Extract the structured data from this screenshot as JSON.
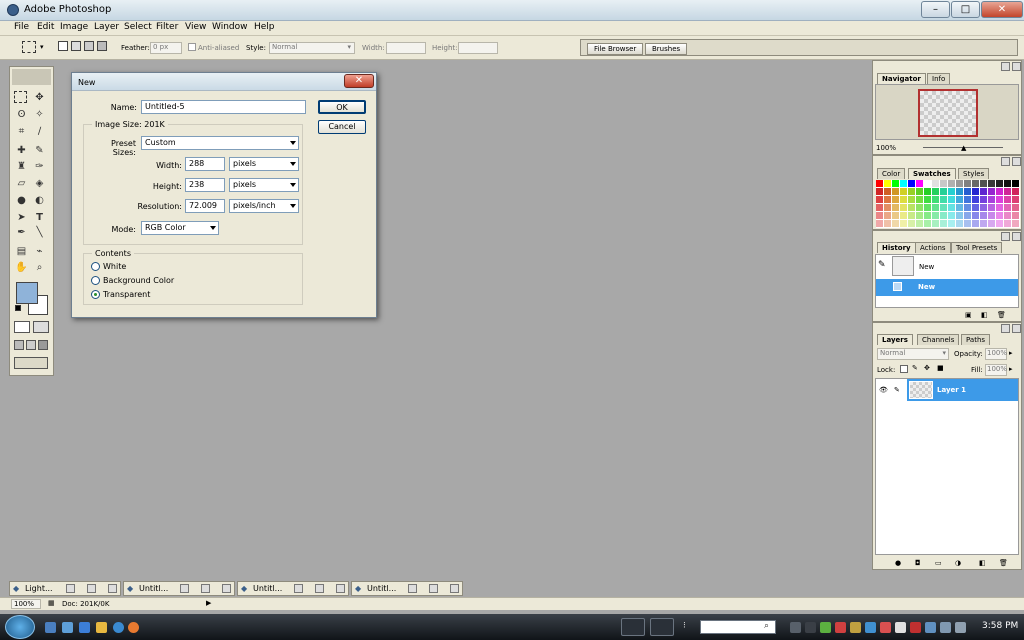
{
  "app": {
    "title": "Adobe Photoshop"
  },
  "menu": [
    "File",
    "Edit",
    "Image",
    "Layer",
    "Select",
    "Filter",
    "View",
    "Window",
    "Help"
  ],
  "options": {
    "feather_label": "Feather:",
    "feather_value": "0 px",
    "antialiased": "Anti-aliased",
    "style_label": "Style:",
    "style_value": "Normal",
    "width_label": "Width:",
    "height_label": "Height:",
    "well_tabs": [
      "File Browser",
      "Brushes"
    ]
  },
  "dialog": {
    "title": "New",
    "name_label": "Name:",
    "name_value": "Untitled-5",
    "image_size": "Image Size: 201K",
    "preset_label": "Preset Sizes:",
    "preset_value": "Custom",
    "width_label": "Width:",
    "width_value": "288",
    "width_unit": "pixels",
    "height_label": "Height:",
    "height_value": "238",
    "height_unit": "pixels",
    "res_label": "Resolution:",
    "res_value": "72.009",
    "res_unit": "pixels/inch",
    "mode_label": "Mode:",
    "mode_value": "RGB Color",
    "contents_label": "Contents",
    "contents": [
      "White",
      "Background Color",
      "Transparent"
    ],
    "selected_content": 2,
    "ok": "OK",
    "cancel": "Cancel"
  },
  "navigator": {
    "tabs": [
      "Navigator",
      "Info"
    ],
    "zoom": "100%"
  },
  "color_panel": {
    "tabs": [
      "Color",
      "Swatches",
      "Styles"
    ]
  },
  "history": {
    "tabs": [
      "History",
      "Actions",
      "Tool Presets"
    ],
    "snapshot": "New",
    "items": [
      "New"
    ]
  },
  "layers": {
    "tabs": [
      "Layers",
      "Channels",
      "Paths"
    ],
    "blend": "Normal",
    "opacity_label": "Opacity:",
    "opacity": "100%",
    "lock_label": "Lock:",
    "fill_label": "Fill:",
    "fill": "100%",
    "layer_name": "Layer 1"
  },
  "documents": [
    "Light...",
    "Untitl...",
    "Untitl...",
    "Untitl..."
  ],
  "status": {
    "zoom": "100%",
    "doc": "Doc: 201K/0K"
  },
  "taskbar": {
    "time": "3:58 PM"
  },
  "colors": {
    "accent": "#3b8de0",
    "selection": "#3d9ae8",
    "foreground": "#8fb3d9",
    "background": "#ffffff"
  }
}
